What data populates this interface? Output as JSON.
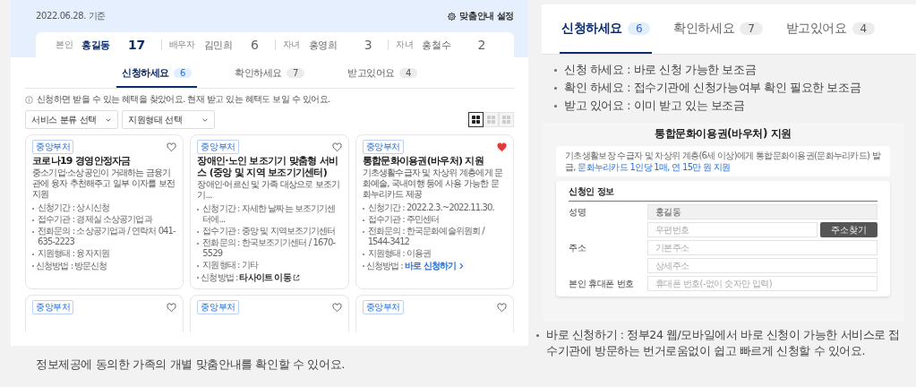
{
  "left_panel": {
    "date": "2022.06.28. 기준",
    "settings_link": "맞춤안내 설정",
    "family": [
      {
        "relation": "본인",
        "name": "홍길동",
        "count": "17",
        "selected": true
      },
      {
        "relation": "배우자",
        "name": "김민희",
        "count": "6",
        "selected": false
      },
      {
        "relation": "자녀",
        "name": "홍영희",
        "count": "3",
        "selected": false
      },
      {
        "relation": "자녀",
        "name": "홍철수",
        "count": "2",
        "selected": false
      }
    ],
    "tabs": [
      {
        "label": "신청하세요",
        "count": "6",
        "selected": true
      },
      {
        "label": "확인하세요",
        "count": "7",
        "selected": false
      },
      {
        "label": "받고있어요",
        "count": "4",
        "selected": false
      }
    ],
    "notice": "신청하면 받을 수 있는 혜택을 찾았어요. 현재 받고 있는 혜택도 보일 수 있어요.",
    "filters": [
      "서비스 분류 선택",
      "지원형태 선택"
    ],
    "view_modes": [
      {
        "selected": true
      },
      {
        "selected": false
      },
      {
        "selected": false
      }
    ],
    "cards": [
      {
        "tag": "중앙부처",
        "liked": false,
        "title": "코로나19 경영안정자금",
        "description": "중소기업·소상공인이 거래하는 금융기관에 융자 추천해주고 일부 이자를 보전 지원",
        "details": [
          "신청기간 : 상시신청",
          "접수기관 : 경제실 소상공기업과",
          "전화문의 : 소상공기업과 / 연락처 041-635-2223",
          "지원형태 : 융자지원"
        ],
        "method_label": "신청방법 : ",
        "method": {
          "kind": "text",
          "text": "방문신청"
        }
      },
      {
        "tag": "중앙부처",
        "liked": false,
        "title": "장애인·노인 보조기기 맞춤형 서비스 (중앙 및 지역 보조기기센터)",
        "description": "장애인·어르신 및 가족 대상으로 보조기기...",
        "details": [
          "신청기간 : 자세한 날짜는 보조기기센터에...",
          "접수기관 : 중앙 및 지역보조기기센터",
          "전화문의 : 한국보조기기센터 / 1670-5529",
          "지원형태 : 기타"
        ],
        "method_label": "신청방법 : ",
        "method": {
          "kind": "external",
          "text": "타사이트 이동"
        }
      },
      {
        "tag": "중앙부처",
        "liked": true,
        "title": "통합문화이용권(바우처) 지원",
        "description": "기초생활수급자 및 차상위 계층에게 문화예술, 국내여행 등에 사용 가능한 문화누리카드 제공",
        "details": [
          "신청기간 : 2022.2.3.~2022.11.30.",
          "접수기관 : 주민센터",
          "전화문의 : 한국문화예술위원회 / 1544-3412",
          "지원형태 : 이용권"
        ],
        "method_label": "신청방법 : ",
        "method": {
          "kind": "direct",
          "text": "바로 신청하기"
        }
      }
    ],
    "more_cards": [
      {
        "tag": "중앙부처",
        "liked": false
      },
      {
        "tag": "중앙부처",
        "liked": false
      },
      {
        "tag": "중앙부처",
        "liked": false
      }
    ]
  },
  "left_caption": "정보제공에 동의한 가족의 개별 맞춤안내를 확인할 수 있어요.",
  "tabs_closeup": [
    {
      "label": "신청하세요",
      "count": "6",
      "selected": true
    },
    {
      "label": "확인하세요",
      "count": "7",
      "selected": false
    },
    {
      "label": "받고있어요",
      "count": "4",
      "selected": false
    }
  ],
  "tab_legend": [
    "신청 하세요 : 바로 신청 가능한 보조금",
    "확인 하세요 : 접수기관에 신청가능여부 확인 필요한 보조금",
    "받고 있어요 : 이미 받고 있는 보조금"
  ],
  "form_preview": {
    "title": "통합문화이용권(바우처) 지원",
    "info": "기초생활보장 수급자 및 차상위 계층(6세 이상)에게 통합문화이용권(문화누리카드) 발급, ",
    "info_highlight": "문화누리카드 1인당 1매, 연 15만 원 지원",
    "section": "신청인 정보",
    "rows": [
      {
        "label": "성명",
        "fields": [
          {
            "value": "홍길동",
            "readonly": true
          }
        ]
      },
      {
        "label": "주소",
        "fields": [
          {
            "placeholder": "우편번호",
            "button": "주소찾기"
          },
          {
            "placeholder": "기본주소"
          },
          {
            "placeholder": "상세주소"
          }
        ]
      },
      {
        "label": "본인 휴대폰 번호",
        "fields": [
          {
            "placeholder": "휴대폰 번호(-없이 숫자만 입력)"
          }
        ]
      }
    ]
  },
  "right_caption": "바로 신청하기 : 정부24 웹/모바일에서 바로 신청이 가능한 서비스로 접수기관에 방문하는 번거로움없이 쉽고 빠르게 신청할 수 있어요."
}
